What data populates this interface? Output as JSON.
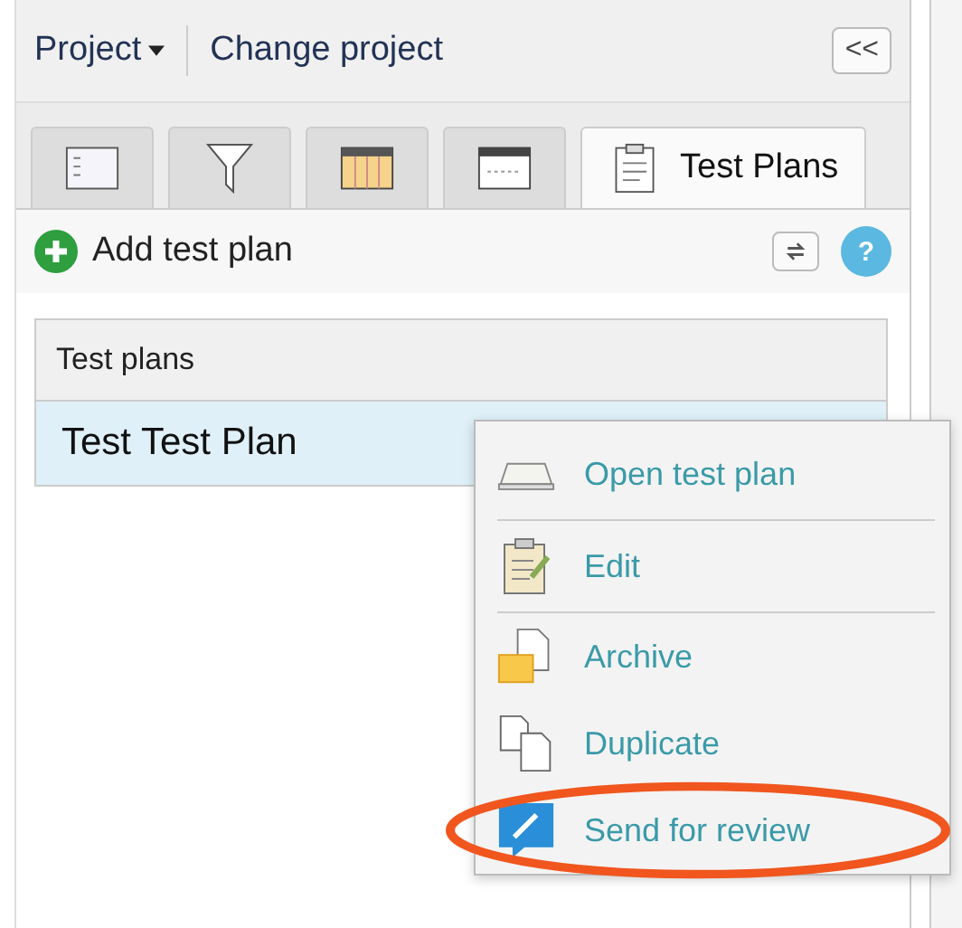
{
  "header": {
    "project_menu": "Project",
    "change_project": "Change project",
    "collapse": "<<"
  },
  "tabs": [
    {
      "kind": "list",
      "selected": false
    },
    {
      "kind": "filter",
      "selected": false
    },
    {
      "kind": "calendar",
      "selected": false
    },
    {
      "kind": "window",
      "selected": false
    },
    {
      "kind": "plans",
      "label": "Test Plans",
      "selected": true
    }
  ],
  "toolbar": {
    "add_label": "Add test plan",
    "help": "?"
  },
  "list": {
    "heading": "Test plans",
    "rows": [
      {
        "name": "Test Test Plan",
        "selected": true
      }
    ]
  },
  "context_menu": [
    {
      "kind": "open",
      "label": "Open test plan",
      "divider_after": true,
      "annotated": false
    },
    {
      "kind": "edit",
      "label": "Edit",
      "divider_after": true,
      "annotated": false
    },
    {
      "kind": "archive",
      "label": "Archive",
      "divider_after": false,
      "annotated": false
    },
    {
      "kind": "duplicate",
      "label": "Duplicate",
      "divider_after": false,
      "annotated": false
    },
    {
      "kind": "review",
      "label": "Send for review",
      "divider_after": false,
      "annotated": true
    }
  ]
}
